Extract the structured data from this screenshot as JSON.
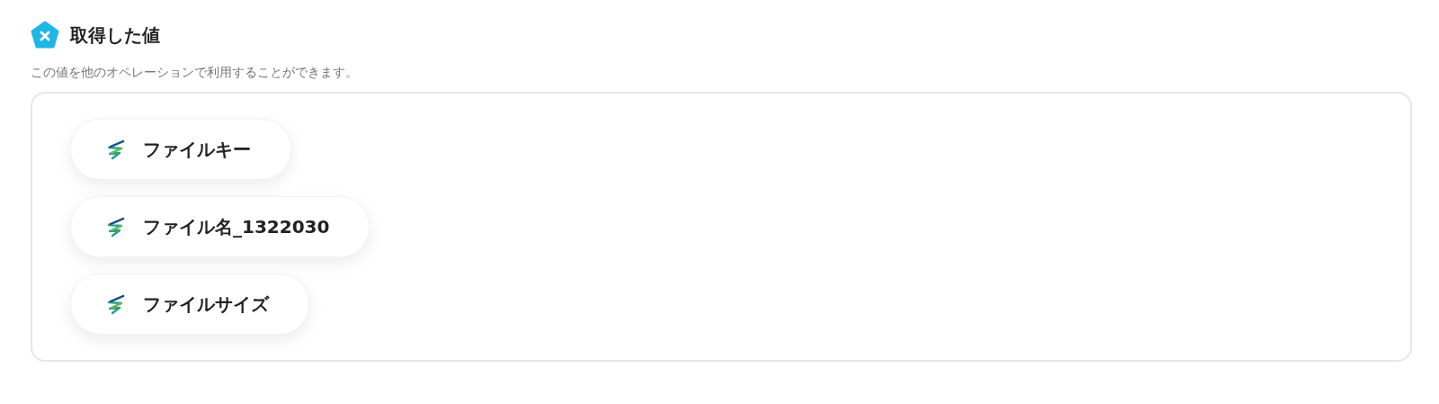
{
  "header": {
    "title": "取得した値",
    "description": "この値を他のオペレーションで利用することができます。"
  },
  "values": [
    {
      "label": "ファイルキー"
    },
    {
      "label": "ファイル名_1322030"
    },
    {
      "label": "ファイルサイズ"
    }
  ]
}
